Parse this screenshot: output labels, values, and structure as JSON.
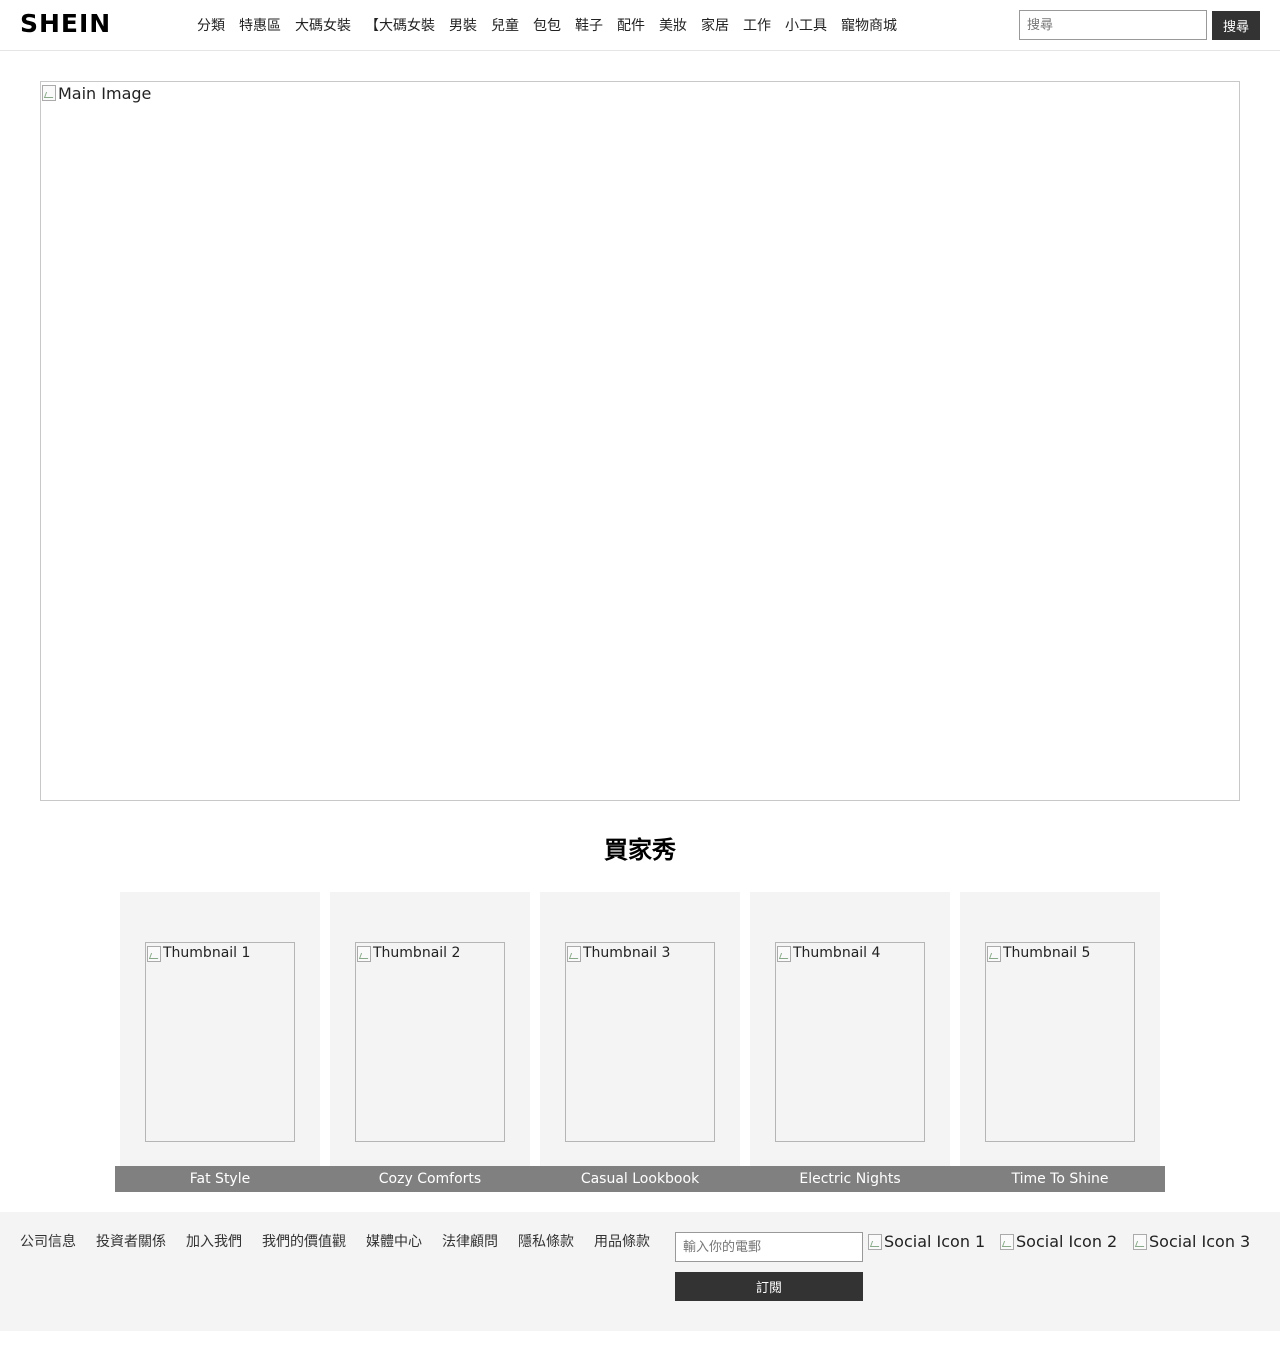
{
  "header": {
    "logo": "SHEIN",
    "nav": [
      "分類",
      "特惠區",
      "大碼女裝",
      "【大碼女裝",
      "男裝",
      "兒童",
      "包包",
      "鞋子",
      "配件",
      "美妝",
      "家居",
      "工作",
      "小工具",
      "寵物商城"
    ],
    "search_placeholder": "搜尋",
    "search_button": "搜尋"
  },
  "main": {
    "main_image_alt": "Main Image"
  },
  "showcase": {
    "title": "買家秀",
    "cards": [
      {
        "alt": "Thumbnail 1",
        "caption": "Fat Style"
      },
      {
        "alt": "Thumbnail 2",
        "caption": "Cozy Comforts"
      },
      {
        "alt": "Thumbnail 3",
        "caption": "Casual Lookbook"
      },
      {
        "alt": "Thumbnail 4",
        "caption": "Electric Nights"
      },
      {
        "alt": "Thumbnail 5",
        "caption": "Time To Shine"
      }
    ]
  },
  "footer": {
    "links": [
      "公司信息",
      "投資者關係",
      "加入我們",
      "我們的價值觀",
      "媒體中心",
      "法律顧問",
      "隱私條款",
      "用品條款"
    ],
    "email_placeholder": "輸入你的電郵",
    "subscribe_button": "訂閱",
    "social": [
      "Social Icon 1",
      "Social Icon 2",
      "Social Icon 3"
    ]
  },
  "colors": {
    "button_bg": "#333333",
    "caption_bg": "#808080",
    "panel_bg": "#f4f4f4"
  }
}
